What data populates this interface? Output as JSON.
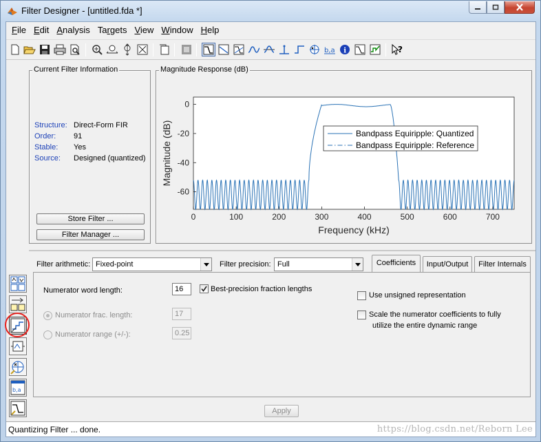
{
  "window": {
    "title": "Filter Designer - [untitled.fda *]"
  },
  "menu": [
    {
      "accel": "F",
      "rest": "ile"
    },
    {
      "accel": "E",
      "rest": "dit"
    },
    {
      "accel": "A",
      "rest": "nalysis"
    },
    {
      "accel": "",
      "pre": "Ta",
      "accel2": "r",
      "rest": "gets"
    },
    {
      "accel": "V",
      "rest": "iew"
    },
    {
      "accel": "W",
      "rest": "indow"
    },
    {
      "accel": "H",
      "rest": "elp"
    }
  ],
  "toolbar_icons": [
    "new-icon",
    "open-icon",
    "save-icon",
    "print-icon",
    "print-preview-icon",
    "zoom-in-icon",
    "zoom-x-icon",
    "zoom-y-icon",
    "full-view-icon",
    "new-figure-icon",
    "filter-manager-icon",
    "magnitude-icon",
    "phase-icon",
    "mag-phase-icon",
    "group-delay-icon",
    "phase-delay-icon",
    "impulse-icon",
    "step-icon",
    "pole-zero-icon",
    "coefficients-icon",
    "info-icon",
    "magnitude-estimate-icon",
    "noise-icon",
    "whats-this-icon"
  ],
  "current_filter": {
    "title": "Current Filter Information",
    "rows": [
      {
        "key": "Structure:",
        "value": "Direct-Form FIR"
      },
      {
        "key": "Order:",
        "value": "91"
      },
      {
        "key": "Stable:",
        "value": "Yes"
      },
      {
        "key": "Source:",
        "value": "Designed (quantized)"
      }
    ],
    "store_button": "Store Filter ...",
    "manager_button": "Filter Manager ..."
  },
  "magnitude_panel": {
    "title": "Magnitude Response (dB)"
  },
  "chart_data": {
    "type": "line",
    "xlabel": "Frequency (kHz)",
    "ylabel": "Magnitude (dB)",
    "xlim": [
      0,
      750
    ],
    "ylim": [
      -72,
      5
    ],
    "x_ticks": [
      "0",
      "100",
      "200",
      "300",
      "400",
      "500",
      "600",
      "700"
    ],
    "y_ticks": [
      "0",
      "-20",
      "-40",
      "-60"
    ],
    "legend_position": "top-right",
    "series": [
      {
        "name": "Bandpass Equiripple: Quantized",
        "style": "solid",
        "color": "#2a72b5",
        "passband": [
          300,
          460
        ],
        "passband_ripple_db": 1,
        "stopband_floor_db": -72,
        "stopband_peak_db": -52,
        "transition_low": [
          270,
          300
        ],
        "transition_high": [
          460,
          480
        ]
      },
      {
        "name": "Bandpass Equiripple: Reference",
        "style": "dashdot",
        "color": "#2a72b5"
      }
    ]
  },
  "quantization": {
    "filter_arithmetic_label": "Filter arithmetic:",
    "filter_arithmetic_value": "Fixed-point",
    "filter_precision_label": "Filter precision:",
    "filter_precision_value": "Full",
    "tabs": [
      "Coefficients",
      "Input/Output",
      "Filter Internals"
    ],
    "num_word_length_label": "Numerator word length:",
    "num_word_length_value": "16",
    "best_precision_label": "Best-precision fraction lengths",
    "num_frac_length_label": "Numerator frac. length:",
    "num_frac_length_value": "17",
    "num_range_label": "Numerator range (+/-):",
    "num_range_value": "0.25",
    "unsigned_label": "Use unsigned representation",
    "scale_label_1": "Scale the numerator coefficients to fully",
    "scale_label_2": "utilize the entire dynamic range",
    "apply_button": "Apply"
  },
  "status": {
    "text": "Quantizing Filter ... done.",
    "watermark": "https://blog.csdn.net/Reborn Lee"
  }
}
